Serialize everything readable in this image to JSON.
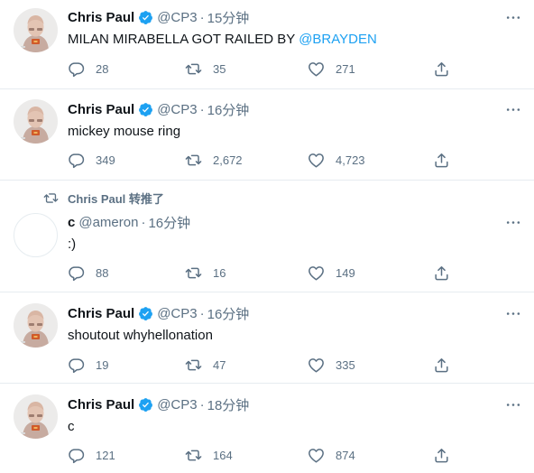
{
  "tweets": [
    {
      "name": "Chris Paul",
      "handle": "@CP3",
      "time": "15分钟",
      "text": "MILAN MIRABELLA GOT RAILED BY ",
      "mention": "@BRAYDEN",
      "replies": "28",
      "retweets": "35",
      "likes": "271"
    },
    {
      "name": "Chris Paul",
      "handle": "@CP3",
      "time": "16分钟",
      "text": "mickey mouse ring",
      "replies": "349",
      "retweets": "2,672",
      "likes": "4,723"
    },
    {
      "retweeted_by": "Chris Paul 转推了",
      "name": "c",
      "handle": "@ameron",
      "time": "16分钟",
      "text": ":)",
      "replies": "88",
      "retweets": "16",
      "likes": "149"
    },
    {
      "name": "Chris Paul",
      "handle": "@CP3",
      "time": "16分钟",
      "text": "shoutout whyhellonation",
      "replies": "19",
      "retweets": "47",
      "likes": "335"
    },
    {
      "name": "Chris Paul",
      "handle": "@CP3",
      "time": "18分钟",
      "text": "c",
      "replies": "121",
      "retweets": "164",
      "likes": "874"
    }
  ],
  "separator": "·",
  "icons": {
    "verified": "verified-badge-icon",
    "more": "more-options-icon",
    "reply": "reply-icon",
    "retweet": "retweet-icon",
    "like": "like-icon",
    "share": "share-icon"
  },
  "colors": {
    "accent": "#1da1f2",
    "muted": "#5b7083",
    "text": "#0f1419",
    "divider": "#e6ecf0"
  }
}
